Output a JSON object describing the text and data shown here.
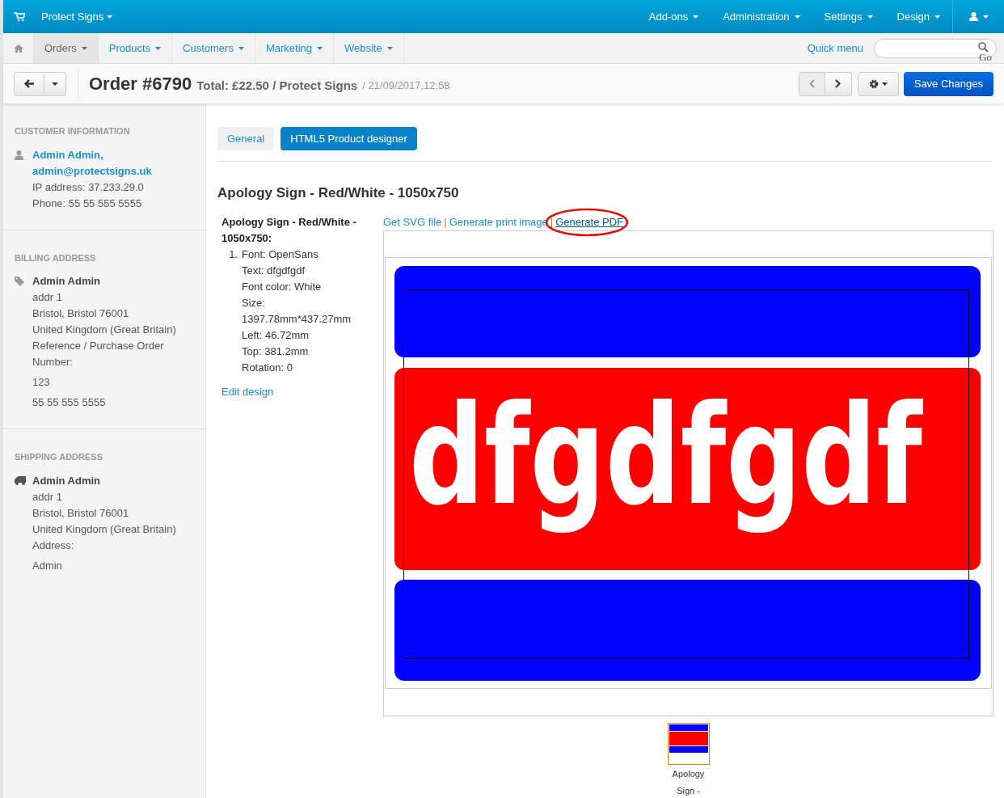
{
  "top_nav": {
    "brand": "Protect Signs",
    "menus": [
      "Add-ons",
      "Administration",
      "Settings",
      "Design"
    ]
  },
  "sub_nav": {
    "items": [
      {
        "label": "Orders",
        "selected": true
      },
      {
        "label": "Products",
        "selected": false
      },
      {
        "label": "Customers",
        "selected": false
      },
      {
        "label": "Marketing",
        "selected": false
      },
      {
        "label": "Website",
        "selected": false
      }
    ],
    "quick_menu": "Quick menu",
    "search_button": "Go"
  },
  "header": {
    "title": "Order #6790",
    "summary": "Total: £22.50 / Protect Signs",
    "date": "/ 21/09/2017,12:58",
    "save_button": "Save Changes"
  },
  "sidebar": [
    {
      "heading": "CUSTOMER INFORMATION",
      "kind": "person",
      "blocks": [
        [
          {
            "kind": "link",
            "text": "Admin Admin,"
          },
          {
            "kind": "link",
            "text": "admin@protectsigns.uk"
          },
          {
            "kind": "text",
            "text": "IP address: 37.233.29.0"
          },
          {
            "kind": "text",
            "text": "Phone: 55 55 555 5555"
          }
        ]
      ]
    },
    {
      "heading": "BILLING ADDRESS",
      "kind": "tag",
      "blocks": [
        [
          {
            "kind": "name",
            "text": "Admin Admin"
          },
          {
            "kind": "text",
            "text": "addr 1"
          },
          {
            "kind": "text",
            "text": "Bristol, Bristol 76001"
          },
          {
            "kind": "text",
            "text": "United Kingdom (Great Britain)"
          },
          {
            "kind": "text",
            "text": "Reference / Purchase Order Number:"
          }
        ],
        [
          {
            "kind": "text",
            "text": "123"
          }
        ],
        [
          {
            "kind": "text",
            "text": "55 55 555 5555"
          }
        ]
      ]
    },
    {
      "heading": "SHIPPING ADDRESS",
      "kind": "truck",
      "blocks": [
        [
          {
            "kind": "name",
            "text": "Admin Admin"
          },
          {
            "kind": "text",
            "text": "addr 1"
          },
          {
            "kind": "text",
            "text": "Bristol, Bristol 76001"
          },
          {
            "kind": "text",
            "text": "United Kingdom (Great Britain)"
          },
          {
            "kind": "text",
            "text": "Address:"
          }
        ],
        [
          {
            "kind": "text",
            "text": "Admin"
          }
        ]
      ]
    }
  ],
  "tabs": [
    {
      "label": "General",
      "selected": false
    },
    {
      "label": "HTML5 Product designer",
      "selected": true
    }
  ],
  "product": {
    "title": "Apology Sign - Red/White - 1050x750",
    "details_heading": "Apology Sign - Red/White - 1050x750:",
    "items": [
      {
        "number": "1.",
        "lines": [
          "Font: OpenSans",
          "Text: dfgdfgdf",
          "Font color: White",
          "Size: 1397.78mm*437.27mm",
          "Left: 46.72mm",
          "Top: 381.2mm",
          "Rotation: 0"
        ]
      }
    ],
    "edit_link": "Edit design",
    "links": [
      {
        "label": "Get SVG file",
        "circled": false
      },
      {
        "separator": "|",
        "label": "Generate print image",
        "circled": false
      },
      {
        "separator": "|",
        "label": "Generate PDF",
        "circled": true
      }
    ],
    "sign_text": "dfgdfgdf",
    "thumbnails": [
      {
        "caption": "Apology Sign -",
        "selected": true
      }
    ]
  }
}
